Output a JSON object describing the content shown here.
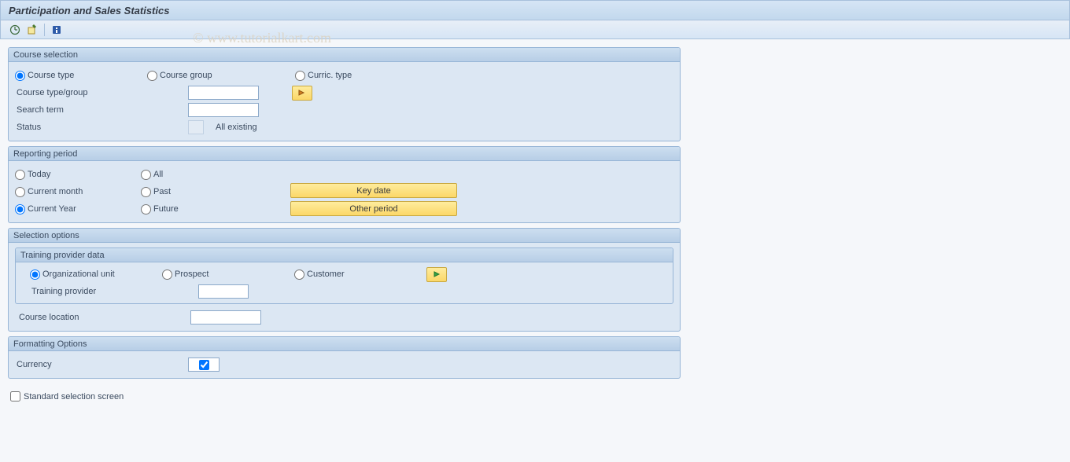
{
  "title": "Participation and Sales Statistics",
  "watermark": "© www.tutorialkart.com",
  "toolbar": {
    "execute_icon": "execute",
    "variant_icon": "variant",
    "info_icon": "info"
  },
  "course_selection": {
    "title": "Course selection",
    "radio": {
      "course_type": "Course type",
      "course_group": "Course group",
      "curric_type": "Curric. type"
    },
    "labels": {
      "course_type_group": "Course type/group",
      "search_term": "Search term",
      "status": "Status"
    },
    "status_text": "All existing",
    "values": {
      "course_type_group": "",
      "search_term": "",
      "status": ""
    }
  },
  "reporting_period": {
    "title": "Reporting period",
    "radio": {
      "today": "Today",
      "current_month": "Current month",
      "current_year": "Current Year",
      "all": "All",
      "past": "Past",
      "future": "Future"
    },
    "buttons": {
      "key_date": "Key date",
      "other_period": "Other period"
    }
  },
  "selection_options": {
    "title": "Selection options",
    "training_provider_data": {
      "title": "Training provider data",
      "radio": {
        "org_unit": "Organizational unit",
        "prospect": "Prospect",
        "customer": "Customer"
      },
      "labels": {
        "training_provider": "Training provider"
      },
      "values": {
        "training_provider": ""
      }
    },
    "labels": {
      "course_location": "Course location"
    },
    "values": {
      "course_location": ""
    }
  },
  "formatting_options": {
    "title": "Formatting Options",
    "labels": {
      "currency": "Currency"
    },
    "currency_checked": true
  },
  "standard_selection": {
    "label": "Standard selection screen",
    "checked": false
  }
}
